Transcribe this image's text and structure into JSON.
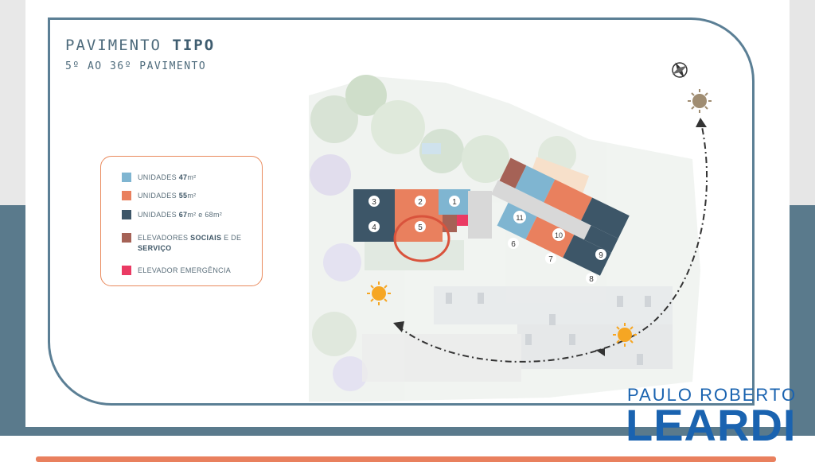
{
  "title": {
    "main": "PAVIMENTO",
    "bold": "TIPO"
  },
  "subtitle": "5º AO 36º PAVIMENTO",
  "legend": {
    "items": [
      {
        "label_pre": "UNIDADES ",
        "label_bold": "47",
        "label_post": "m²",
        "color": "#7fb5d1"
      },
      {
        "label_pre": "UNIDADES ",
        "label_bold": "55",
        "label_post": "m²",
        "color": "#e9805e"
      },
      {
        "label_pre": "UNIDADES ",
        "label_bold": "67",
        "label_post": "m² e 68m²",
        "color": "#3d5668"
      },
      {
        "label_pre": "ELEVADORES ",
        "label_bold": "SOCIAIS",
        "label_post": " E DE",
        "line2": "SERVIÇO",
        "color": "#a56256"
      },
      {
        "label_pre": "ELEVADOR EMERGÊNCIA",
        "label_bold": "",
        "label_post": "",
        "color": "#ea3a63"
      }
    ]
  },
  "units": [
    "1",
    "2",
    "3",
    "4",
    "5",
    "6",
    "7",
    "8",
    "9",
    "10",
    "11"
  ],
  "watermark": {
    "line1": "PAULO ROBERTO",
    "line2": "LEARDI"
  },
  "colors": {
    "frame": "#5b7f95",
    "light_blue": "#7fb5d1",
    "orange": "#e9805e",
    "dark_blue": "#3d5668",
    "elevator": "#a56256",
    "emergency": "#ea3a63"
  }
}
